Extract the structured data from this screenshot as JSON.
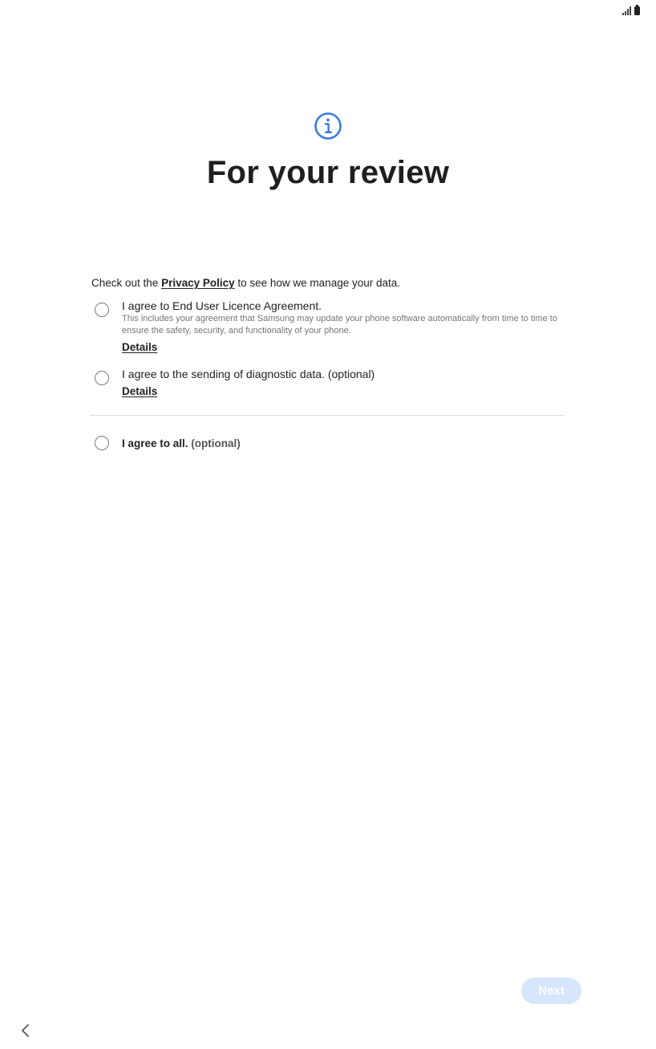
{
  "header": {
    "title": "For your review",
    "icon": "info-icon"
  },
  "privacy": {
    "prefix": "Check out the ",
    "link": "Privacy Policy",
    "suffix": " to see how we manage your data."
  },
  "agreements": [
    {
      "title": "I agree to End User Licence Agreement.",
      "description": "This includes your agreement that Samsung may update your phone software automatically from time to time to ensure the safety, security, and functionality of your phone.",
      "details": "Details",
      "checked": false
    },
    {
      "title": "I agree to the sending of diagnostic data. (optional)",
      "details": "Details",
      "checked": false
    }
  ],
  "agree_all": {
    "label": "I agree to all.",
    "optional": "(optional)",
    "checked": false
  },
  "footer": {
    "next_label": "Next",
    "back_icon": "chevron-left-icon"
  },
  "colors": {
    "accent": "#3b7be0",
    "next_disabled_bg": "#d6e6fb"
  }
}
